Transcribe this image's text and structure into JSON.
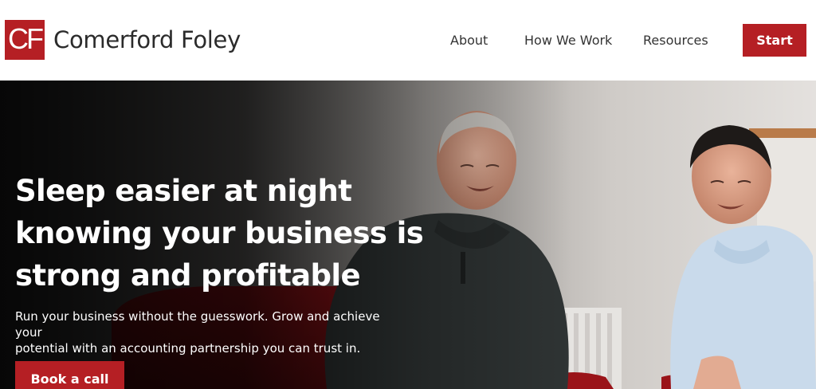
{
  "brand": {
    "logo_letters": "CF",
    "name": "Comerford Foley",
    "accent_color": "#b51f24"
  },
  "nav": {
    "items": [
      {
        "label": "About"
      },
      {
        "label": "How We Work"
      },
      {
        "label": "Resources"
      }
    ],
    "cta_label": "Start"
  },
  "hero": {
    "heading_lines": [
      "Sleep easier at night",
      "knowing your business is",
      "strong and profitable"
    ],
    "subtext_lines": [
      "Run your business without the guesswork. Grow and achieve your",
      "potential with an accounting partnership you can trust in."
    ],
    "cta_label": "Book a call",
    "image": "photo of two smiling men seated in red chairs"
  }
}
